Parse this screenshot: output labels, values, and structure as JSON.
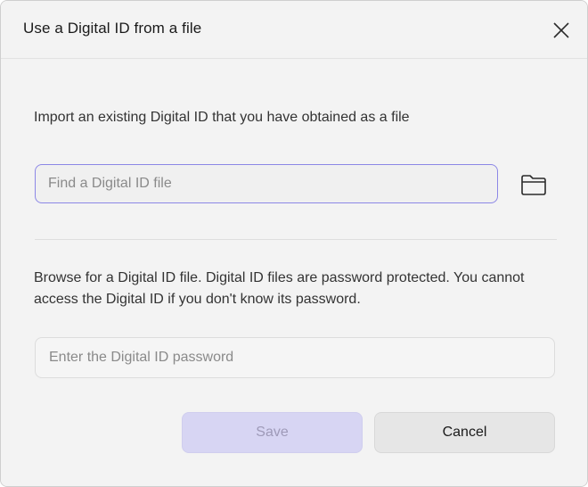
{
  "dialog": {
    "title": "Use a Digital ID from a file",
    "close_icon": "close-icon"
  },
  "import_section": {
    "description": "Import an existing Digital ID that you have obtained as a file",
    "file_input": {
      "value": "",
      "placeholder": "Find a Digital ID file"
    },
    "browse_icon": "folder-icon"
  },
  "password_section": {
    "description": "Browse for a Digital ID file. Digital ID files are password protected. You cannot access the Digital ID if you don't know its password.",
    "password_input": {
      "value": "",
      "placeholder": "Enter the Digital ID password"
    }
  },
  "buttons": {
    "save_label": "Save",
    "save_enabled": false,
    "cancel_label": "Cancel"
  },
  "colors": {
    "focus_border": "#8c87e6",
    "save_disabled_bg": "#d7d5f3",
    "dialog_bg": "#f3f3f3"
  }
}
